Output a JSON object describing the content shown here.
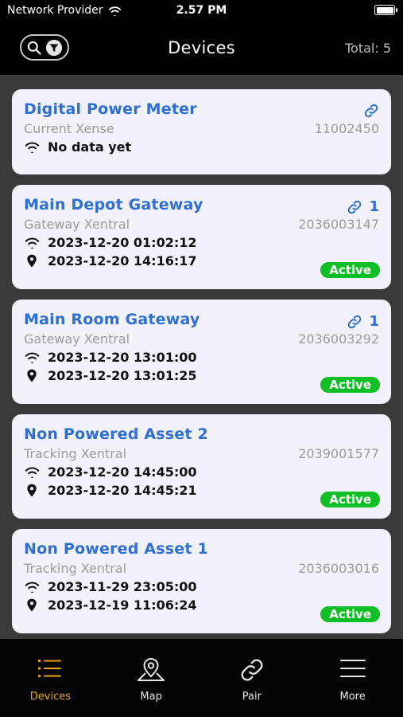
{
  "status_bar": {
    "carrier": "Network Provider",
    "time": "2.57 PM"
  },
  "header": {
    "title": "Devices",
    "total": "Total: 5",
    "search_icon": "search-icon",
    "filter_icon": "filter-icon"
  },
  "colors": {
    "accent_blue": "#2e6fd1",
    "active_green": "#0fbf25",
    "tab_active": "#e9a51c",
    "card_bg": "#f3f2fb"
  },
  "devices": [
    {
      "name": "Digital Power Meter",
      "type": "Current Xense",
      "serial": "11002450",
      "link_count": "",
      "line1": "No data yet",
      "line2": "",
      "status": ""
    },
    {
      "name": "Main Depot Gateway",
      "type": "Gateway Xentral",
      "serial": "2036003147",
      "link_count": "1",
      "line1": "2023-12-20 01:02:12",
      "line2": "2023-12-20 14:16:17",
      "status": "Active"
    },
    {
      "name": "Main Room Gateway",
      "type": "Gateway Xentral",
      "serial": "2036003292",
      "link_count": "1",
      "line1": "2023-12-20 13:01:00",
      "line2": "2023-12-20 13:01:25",
      "status": "Active"
    },
    {
      "name": "Non Powered Asset 2",
      "type": "Tracking Xentral",
      "serial": "2039001577",
      "link_count": "",
      "line1": "2023-12-20 14:45:00",
      "line2": "2023-12-20 14:45:21",
      "status": "Active"
    },
    {
      "name": "Non Powered Asset 1",
      "type": "Tracking Xentral",
      "serial": "2036003016",
      "link_count": "",
      "line1": "2023-11-29 23:05:00",
      "line2": "2023-12-19 11:06:24",
      "status": "Active"
    }
  ],
  "tabs": [
    {
      "label": "Devices",
      "icon": "list-icon",
      "active": true
    },
    {
      "label": "Map",
      "icon": "map-pin-icon",
      "active": false
    },
    {
      "label": "Pair",
      "icon": "link-icon",
      "active": false
    },
    {
      "label": "More",
      "icon": "menu-icon",
      "active": false
    }
  ]
}
